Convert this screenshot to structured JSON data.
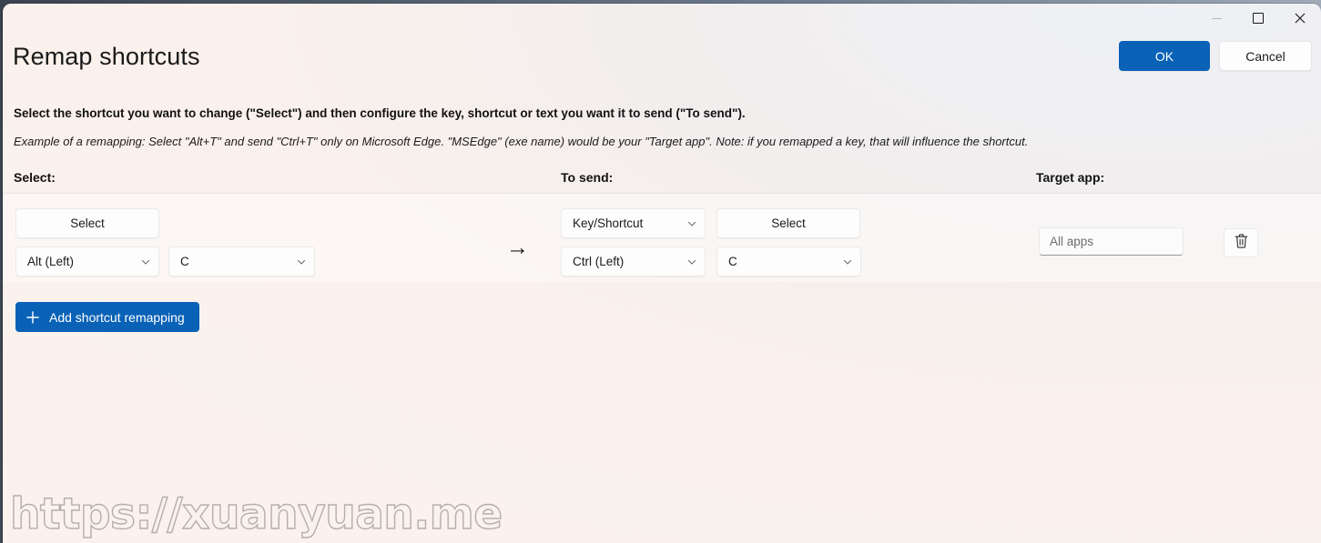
{
  "window": {
    "title": "Remap shortcuts",
    "controls": {
      "minimize": "Minimize",
      "maximize": "Maximize",
      "close": "Close"
    }
  },
  "header": {
    "ok_label": "OK",
    "cancel_label": "Cancel"
  },
  "description": {
    "line1": "Select the shortcut you want to change (\"Select\") and then configure the key, shortcut or text you want it to send (\"To send\").",
    "line2": "Example of a remapping: Select \"Alt+T\" and send \"Ctrl+T\" only on Microsoft Edge. \"MSEdge\" (exe name) would be your \"Target app\". Note: if you remapped a key, that will influence the shortcut."
  },
  "columns": {
    "select": "Select:",
    "to_send": "To send:",
    "target_app": "Target app:"
  },
  "row": {
    "select": {
      "select_button": "Select",
      "modifier": "Alt (Left)",
      "key": "C"
    },
    "arrow": "→",
    "to_send": {
      "type": "Key/Shortcut",
      "select_button": "Select",
      "modifier": "Ctrl (Left)",
      "key": "C"
    },
    "target_app": {
      "placeholder": "All apps",
      "value": ""
    },
    "delete_tooltip": "Delete remapping"
  },
  "add_button": {
    "label": "Add shortcut remapping",
    "icon": "plus-icon"
  },
  "watermark": {
    "text": "https://xuanyuan.me"
  },
  "colors": {
    "accent": "#0a62b7",
    "background_warm": "#faf1ec",
    "background_cool": "#eef0f5",
    "text": "#1b1b1b"
  }
}
